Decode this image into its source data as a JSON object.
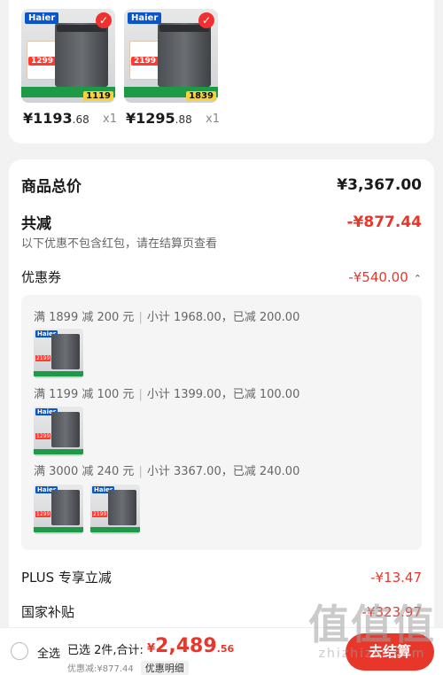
{
  "products": [
    {
      "brand": "Haier",
      "thumb_price_tag": "1299",
      "thumb_price_bar": "1119",
      "price_main": "¥1193",
      "price_dec": ".68",
      "qty": "x1"
    },
    {
      "brand": "Haier",
      "thumb_price_tag": "2199",
      "thumb_price_bar": "1839",
      "price_main": "¥1295",
      "price_dec": ".88",
      "qty": "x1"
    }
  ],
  "summary": {
    "total_label": "商品总价",
    "total_value": "¥3,367.00",
    "discount_label": "共减",
    "discount_value": "-¥877.44",
    "note": "以下优惠不包含红包，请在结算页查看",
    "coupon_label": "优惠券",
    "coupon_value": "-¥540.00"
  },
  "coupon_groups": [
    {
      "rule": "满 1899 减 200 元",
      "detail": "小计 1968.00，已减 200.00"
    },
    {
      "rule": "满 1199 减 100 元",
      "detail": "小计 1399.00，已减 100.00"
    },
    {
      "rule": "满 3000 减 240 元",
      "detail": "小计 3367.00，已减 240.00"
    }
  ],
  "plus": {
    "label": "PLUS 专享立减",
    "value": "-¥13.47"
  },
  "subsidy": {
    "label": "国家补贴",
    "value": "-¥323.97"
  },
  "bottom": {
    "select_all": "全选",
    "selected": "已选 2件,合计:",
    "yen": "¥",
    "total_main": "2,489",
    "total_dec": ".56",
    "sub": "优惠减:¥877.44",
    "detail_btn": "优惠明细",
    "checkout": "去结算"
  },
  "watermark": {
    "big": "值值值",
    "small": "zhizhizhi.com"
  }
}
